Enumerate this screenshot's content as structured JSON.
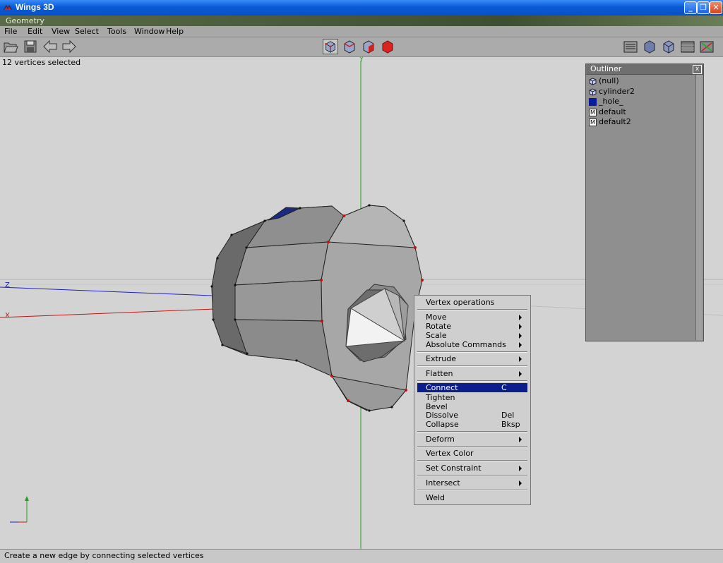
{
  "window": {
    "title": "Wings 3D"
  },
  "geometry_bar": {
    "label": "Geometry"
  },
  "menu": [
    "File",
    "Edit",
    "View",
    "Select",
    "Tools",
    "Window",
    "Help"
  ],
  "viewport": {
    "selection_info": "12 vertices selected",
    "axis_y": "Y",
    "axis_z": "Z",
    "axis_x": "X"
  },
  "outliner": {
    "title": "Outliner",
    "close": "x",
    "items": [
      {
        "label": "(null)",
        "icon": "object-icon"
      },
      {
        "label": "cylinder2",
        "icon": "object-icon"
      },
      {
        "label": "_hole_",
        "icon": "material-icon"
      },
      {
        "label": "default",
        "icon": "material-m-icon"
      },
      {
        "label": "default2",
        "icon": "material-m-icon"
      }
    ]
  },
  "context_menu": {
    "title": "Vertex operations",
    "items": {
      "move": "Move",
      "rotate": "Rotate",
      "scale": "Scale",
      "absolute": "Absolute Commands",
      "extrude": "Extrude",
      "flatten": "Flatten",
      "connect": "Connect",
      "connect_key": "C",
      "tighten": "Tighten",
      "bevel": "Bevel",
      "dissolve": "Dissolve",
      "dissolve_key": "Del",
      "collapse": "Collapse",
      "collapse_key": "Bksp",
      "deform": "Deform",
      "vertex_color": "Vertex Color",
      "set_constraint": "Set Constraint",
      "intersect": "Intersect",
      "weld": "Weld"
    }
  },
  "status": {
    "text": "Create a new edge by connecting selected vertices"
  },
  "colors": {
    "highlight": "#0a1e8c",
    "title_bar": "#0a5ad8"
  }
}
